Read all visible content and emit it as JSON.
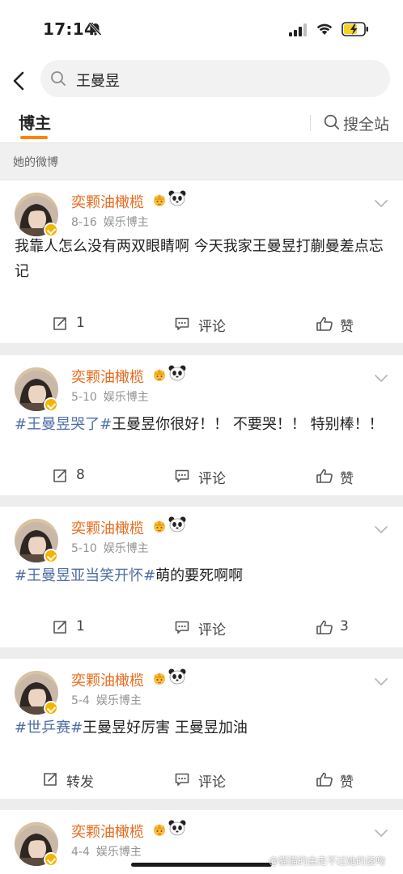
{
  "status_bar": {
    "time": "17:14"
  },
  "search": {
    "query": "王曼昱"
  },
  "tabs": {
    "active": "博主",
    "search_all": "搜全站"
  },
  "section_label": "她的微博",
  "posts": [
    {
      "username": "奕颗油橄榄",
      "date": "8-16",
      "source": "娱乐博主",
      "text_parts": [
        {
          "text": "我靠人怎么没有两双眼睛啊  今天我家王曼昱打蒯曼差点忘记",
          "hashtag": false
        }
      ],
      "repost": "1",
      "comment": "评论",
      "like": "赞"
    },
    {
      "username": "奕颗油橄榄",
      "date": "5-10",
      "source": "娱乐博主",
      "text_parts": [
        {
          "text": "#王曼昱哭了#",
          "hashtag": true
        },
        {
          "text": "王曼昱你很好！！ 不要哭！！ 特别棒！！",
          "hashtag": false
        }
      ],
      "repost": "8",
      "comment": "评论",
      "like": "赞"
    },
    {
      "username": "奕颗油橄榄",
      "date": "5-10",
      "source": "娱乐博主",
      "text_parts": [
        {
          "text": "#王曼昱亚当笑开怀#",
          "hashtag": true
        },
        {
          "text": "萌的要死啊啊",
          "hashtag": false
        }
      ],
      "repost": "1",
      "comment": "评论",
      "like": "3"
    },
    {
      "username": "奕颗油橄榄",
      "date": "5-4",
      "source": "娱乐博主",
      "text_parts": [
        {
          "text": "#世乒赛#",
          "hashtag": true
        },
        {
          "text": "王曼昱好厉害 王曼昱加油",
          "hashtag": false
        }
      ],
      "repost": "转发",
      "comment": "评论",
      "like": "赞"
    },
    {
      "username": "奕颗油橄榄",
      "date": "4-4",
      "source": "娱乐博主",
      "text_parts": [],
      "repost": "",
      "comment": "",
      "like": ""
    }
  ],
  "watermark": "@猫猫的由走不过她的姿吻",
  "colors": {
    "accent": "#ff8200",
    "username": "#e86b1f",
    "hashtag": "#4e6ea7",
    "verified_badge": "#f5b400",
    "battery_fill": "#f4d328"
  },
  "icons": {
    "back": "chevron-left-icon",
    "search": "magnifier-icon",
    "repost": "share-arrow-icon",
    "comment": "comment-bubble-icon",
    "like": "thumbs-up-icon",
    "more": "chevron-down-icon"
  }
}
